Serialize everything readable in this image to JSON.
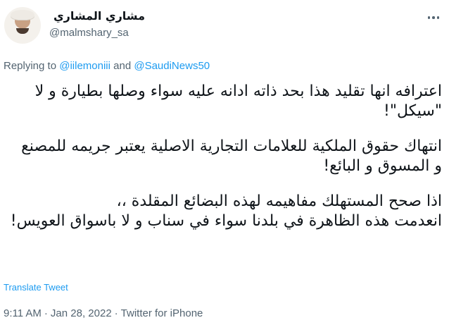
{
  "author": {
    "display_name": "مشاري المشاري",
    "handle": "@malmshary_sa"
  },
  "reply": {
    "prefix": "Replying to ",
    "user1": "@iilemoniii",
    "conjunction": " and ",
    "user2": "@SaudiNews50"
  },
  "tweet": {
    "paragraph1": "اعترافه انها تقليد هذا  بحد ذاته ادانه عليه سواء وصلها بطيارة و لا \"سيكل\"!",
    "paragraph2": "انتهاك حقوق الملكية للعلامات التجارية الاصلية يعتبر جريمه للمصنع و المسوق و البائع!",
    "paragraph3": "اذا صحح المستهلك مفاهيمه لهذه البضائع المقلدة ،،",
    "paragraph3b": "انعدمت هذه الظاهرة في بلدنا سواء في سناب و لا باسواق العويس!"
  },
  "translate_label": "Translate Tweet",
  "meta": {
    "time": "9:11 AM",
    "separator": "·",
    "date": "Jan 28, 2022",
    "source": "Twitter for iPhone"
  },
  "icons": {
    "more": "more-horizontal-icon"
  },
  "colors": {
    "link": "#1d9bf0",
    "secondary_text": "#536471",
    "primary_text": "#0f1419"
  }
}
